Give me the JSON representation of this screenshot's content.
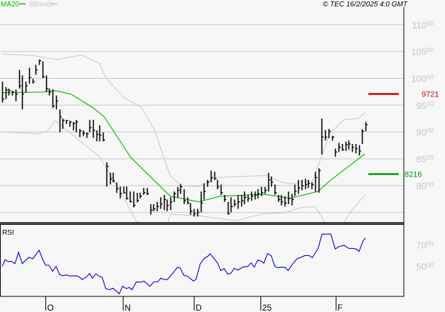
{
  "chart_data": {
    "type": "ohlc",
    "header": {
      "legend": [
        {
          "name": "MA20",
          "color": "#00c000"
        },
        {
          "name": "BBands",
          "color": "#c8c8c8"
        }
      ],
      "copyright": "© TEC 16/2/2025 4:0 GMT"
    },
    "price_axis": {
      "ylim": [
        7310,
        11460
      ],
      "gridlines": [
        11000,
        10500,
        10000,
        9500,
        9000,
        8500,
        8000,
        7500
      ],
      "labels": [
        {
          "main": "110",
          "sup": "00",
          "value": 11000
        },
        {
          "main": "105",
          "sup": "00",
          "value": 10500
        },
        {
          "main": "100",
          "sup": "00",
          "value": 10000
        },
        {
          "main": "95",
          "sup": "00",
          "value": 9500
        },
        {
          "main": "90",
          "sup": "00",
          "value": 9000
        },
        {
          "main": "85",
          "sup": "00",
          "value": 8500
        },
        {
          "main": "80",
          "sup": "00",
          "value": 8000
        }
      ]
    },
    "levels": [
      {
        "label": "9721",
        "value": 9721,
        "color": "#cc0000"
      },
      {
        "label": "8216",
        "value": 8216,
        "color": "#009900"
      }
    ],
    "x_ticks": [
      {
        "label": "O",
        "index": 12.9
      },
      {
        "label": "N",
        "index": 35.9
      },
      {
        "label": "D",
        "index": 57
      },
      {
        "label": "25",
        "index": 76.8
      },
      {
        "label": "F",
        "index": 99.2
      }
    ],
    "bars_hlc": [
      [
        9938,
        9550,
        9615
      ],
      [
        9835,
        9615,
        9783
      ],
      [
        9810,
        9680,
        9770
      ],
      [
        9770,
        9680,
        9744
      ],
      [
        9795,
        9575,
        9705
      ],
      [
        10158,
        9810,
        9860
      ],
      [
        10055,
        9420,
        9705
      ],
      [
        9938,
        9730,
        9860
      ],
      [
        10197,
        9900,
        10016
      ],
      [
        9990,
        9900,
        9938
      ],
      [
        10250,
        10068,
        10158
      ],
      [
        10350,
        10250,
        10327
      ],
      [
        10315,
        10003,
        10030
      ],
      [
        10055,
        9744,
        9810
      ],
      [
        9810,
        9680,
        9744
      ],
      [
        9795,
        9446,
        9485
      ],
      [
        9680,
        9420,
        9576
      ],
      [
        9420,
        8993,
        9278
      ],
      [
        9252,
        9057,
        9213
      ],
      [
        9226,
        9148,
        9213
      ],
      [
        9213,
        9096,
        9187
      ],
      [
        9187,
        9031,
        9160
      ],
      [
        9226,
        8993,
        9187
      ],
      [
        9057,
        8902,
        9018
      ],
      [
        9031,
        8928,
        8980
      ],
      [
        8993,
        8890,
        8967
      ],
      [
        9226,
        8993,
        9083
      ],
      [
        9226,
        8890,
        9031
      ],
      [
        9031,
        8825,
        8954
      ],
      [
        9122,
        8825,
        8940
      ],
      [
        8993,
        8825,
        8850
      ],
      [
        8436,
        7983,
        8358
      ],
      [
        8242,
        8022,
        8125
      ],
      [
        8242,
        8060,
        8086
      ],
      [
        8060,
        7866,
        7944
      ],
      [
        7983,
        7763,
        7853
      ],
      [
        7983,
        7853,
        7866
      ],
      [
        7983,
        7737,
        7763
      ],
      [
        7892,
        7686,
        7700
      ],
      [
        7892,
        7594,
        7633
      ],
      [
        7866,
        7686,
        7724
      ],
      [
        7870,
        7761,
        7805
      ],
      [
        7956,
        7826,
        7870
      ],
      [
        7956,
        7826,
        7848
      ],
      [
        7654,
        7459,
        7545
      ],
      [
        7654,
        7524,
        7567
      ],
      [
        7697,
        7524,
        7610
      ],
      [
        7783,
        7567,
        7654
      ],
      [
        7826,
        7545,
        7740
      ],
      [
        7740,
        7524,
        7632
      ],
      [
        7783,
        7545,
        7697
      ],
      [
        7891,
        7697,
        7848
      ],
      [
        7978,
        7783,
        7913
      ],
      [
        8030,
        7848,
        7978
      ],
      [
        7934,
        7654,
        7718
      ],
      [
        7783,
        7654,
        7675
      ],
      [
        7675,
        7459,
        7524
      ],
      [
        7567,
        7425,
        7480
      ],
      [
        7567,
        7425,
        7502
      ],
      [
        7891,
        7502,
        7675
      ],
      [
        8042,
        7740,
        7891
      ],
      [
        8107,
        7978,
        8064
      ],
      [
        8280,
        8064,
        8150
      ],
      [
        8258,
        8107,
        8129
      ],
      [
        8107,
        7934,
        7978
      ],
      [
        8021,
        7826,
        7870
      ],
      [
        7826,
        7697,
        7740
      ],
      [
        7697,
        7459,
        7480
      ],
      [
        7783,
        7502,
        7610
      ],
      [
        7740,
        7610,
        7654
      ],
      [
        7826,
        7567,
        7697
      ],
      [
        7826,
        7610,
        7718
      ],
      [
        7891,
        7654,
        7783
      ],
      [
        7826,
        7697,
        7761
      ],
      [
        7891,
        7718,
        7805
      ],
      [
        7891,
        7740,
        7826
      ],
      [
        7934,
        7761,
        7848
      ],
      [
        7978,
        7805,
        7870
      ],
      [
        7978,
        7848,
        7913
      ],
      [
        8237,
        7891,
        8107
      ],
      [
        8172,
        7978,
        8064
      ],
      [
        8021,
        7826,
        7870
      ],
      [
        7826,
        7697,
        7740
      ],
      [
        7826,
        7632,
        7697
      ],
      [
        7805,
        7610,
        7675
      ],
      [
        7891,
        7654,
        7761
      ],
      [
        7848,
        7632,
        7740
      ],
      [
        8021,
        7805,
        7891
      ],
      [
        8107,
        7848,
        7956
      ],
      [
        8107,
        7913,
        7999
      ],
      [
        8129,
        7934,
        8021
      ],
      [
        8107,
        7956,
        8042
      ],
      [
        8064,
        7934,
        8021
      ],
      [
        8258,
        7891,
        8150
      ],
      [
        8324,
        7870,
        8280
      ],
      [
        9252,
        8583,
        8906
      ],
      [
        9036,
        8842,
        8906
      ],
      [
        9057,
        8885,
        9014
      ],
      [
        8928,
        8842,
        8906
      ],
      [
        8690,
        8540,
        8626
      ],
      [
        8798,
        8626,
        8712
      ],
      [
        8777,
        8647,
        8669
      ],
      [
        8820,
        8647,
        8764
      ],
      [
        8842,
        8669,
        8777
      ],
      [
        8777,
        8626,
        8712
      ],
      [
        8777,
        8604,
        8690
      ],
      [
        8755,
        8561,
        8647
      ],
      [
        9049,
        8777,
        9014
      ],
      [
        9187,
        9014,
        9135
      ]
    ],
    "ma20": [
      [
        0,
        9731
      ],
      [
        12,
        9744
      ],
      [
        15.8,
        9770
      ],
      [
        20.5,
        9705
      ],
      [
        27.2,
        9446
      ],
      [
        30.4,
        9278
      ],
      [
        38.2,
        8527
      ],
      [
        50,
        7801
      ],
      [
        58.4,
        7698
      ],
      [
        64.8,
        7801
      ],
      [
        77.8,
        7840
      ],
      [
        85.4,
        7763
      ],
      [
        93.9,
        7892
      ],
      [
        97.3,
        8086
      ],
      [
        102.7,
        8345
      ],
      [
        107.8,
        8591
      ]
    ],
    "bband_upper": [
      [
        0,
        10456
      ],
      [
        9.9,
        10417
      ],
      [
        16.2,
        10350
      ],
      [
        23.6,
        10432
      ],
      [
        28.9,
        10285
      ],
      [
        31,
        9990
      ],
      [
        36.3,
        9640
      ],
      [
        41.6,
        9446
      ],
      [
        45.4,
        9018
      ],
      [
        50,
        8177
      ],
      [
        53.4,
        7996
      ],
      [
        58.4,
        7983
      ],
      [
        63.5,
        8151
      ],
      [
        73.6,
        8177
      ],
      [
        78.7,
        8190
      ],
      [
        82.1,
        8086
      ],
      [
        85.4,
        8034
      ],
      [
        92.2,
        8086
      ],
      [
        95.2,
        8579
      ],
      [
        97.3,
        8967
      ],
      [
        101.5,
        9226
      ],
      [
        105.7,
        9252
      ],
      [
        107.8,
        9355
      ]
    ],
    "bband_lower": [
      [
        0,
        9005
      ],
      [
        10.3,
        8967
      ],
      [
        13.3,
        9005
      ],
      [
        15.8,
        9213
      ],
      [
        20.5,
        8967
      ],
      [
        28.9,
        8540
      ],
      [
        34.8,
        7930
      ],
      [
        39.9,
        7335
      ],
      [
        44.7,
        7100
      ],
      [
        49.2,
        7300
      ],
      [
        50,
        7465
      ],
      [
        58.4,
        7440
      ],
      [
        69.4,
        7348
      ],
      [
        77.8,
        7478
      ],
      [
        83.8,
        7491
      ],
      [
        88.8,
        7594
      ],
      [
        93,
        7607
      ],
      [
        96,
        7310
      ],
      [
        98.5,
        7150
      ],
      [
        101.5,
        7300
      ],
      [
        104,
        7542
      ],
      [
        107.8,
        7827
      ]
    ],
    "rsi": {
      "title": "RSI",
      "ylim": [
        21.3,
        89.3
      ],
      "labels": [
        {
          "main": "70",
          "sup": "00",
          "value": 70
        },
        {
          "main": "50",
          "sup": "00",
          "value": 50
        }
      ],
      "points": [
        [
          0,
          49.8
        ],
        [
          0.9,
          56.2
        ],
        [
          1.9,
          54.2
        ],
        [
          2.7,
          54.7
        ],
        [
          3.8,
          52.4
        ],
        [
          4.9,
          63.1
        ],
        [
          6,
          52.4
        ],
        [
          7,
          55.8
        ],
        [
          8,
          58.4
        ],
        [
          9.1,
          56.9
        ],
        [
          11,
          65.1
        ],
        [
          12,
          56.9
        ],
        [
          12.9,
          50.9
        ],
        [
          13.9,
          50.9
        ],
        [
          15,
          45.1
        ],
        [
          16,
          49.8
        ],
        [
          17.1,
          42
        ],
        [
          18.1,
          40.9
        ],
        [
          19.2,
          41.8
        ],
        [
          20,
          40.7
        ],
        [
          22.2,
          40.9
        ],
        [
          23,
          39.6
        ],
        [
          23.8,
          37.3
        ],
        [
          25.1,
          39.8
        ],
        [
          26,
          43.1
        ],
        [
          26.8,
          38.7
        ],
        [
          27.9,
          42.7
        ],
        [
          28.9,
          40.2
        ],
        [
          29.7,
          39.6
        ],
        [
          30.8,
          28.7
        ],
        [
          31.9,
          27.6
        ],
        [
          32.9,
          29.1
        ],
        [
          34,
          26.2
        ],
        [
          34.8,
          23.8
        ],
        [
          35.8,
          30.9
        ],
        [
          36.9,
          28.7
        ],
        [
          37.8,
          29.8
        ],
        [
          38.6,
          27.6
        ],
        [
          39.9,
          35.1
        ],
        [
          41.1,
          34.7
        ],
        [
          42.2,
          35.8
        ],
        [
          43.9,
          30.9
        ],
        [
          45.1,
          35.1
        ],
        [
          46.2,
          35.1
        ],
        [
          47.2,
          38.7
        ],
        [
          48.1,
          37.3
        ],
        [
          49.1,
          37.3
        ],
        [
          50.4,
          42
        ],
        [
          52.1,
          48.9
        ],
        [
          52.9,
          48.4
        ],
        [
          54,
          41.3
        ],
        [
          55.1,
          40.4
        ],
        [
          55.9,
          38.4
        ],
        [
          56.8,
          36
        ],
        [
          57.6,
          37.3
        ],
        [
          58.9,
          52.4
        ],
        [
          60.1,
          57.6
        ],
        [
          61,
          59.1
        ],
        [
          61.8,
          61.6
        ],
        [
          62.7,
          58.4
        ],
        [
          64,
          53.1
        ],
        [
          65,
          45.8
        ],
        [
          66,
          47.6
        ],
        [
          67.1,
          42.4
        ],
        [
          68.1,
          43.6
        ],
        [
          69,
          48
        ],
        [
          70.1,
          46.2
        ],
        [
          71.5,
          49.1
        ],
        [
          73,
          49.8
        ],
        [
          74,
          53.1
        ],
        [
          74.9,
          49.1
        ],
        [
          76,
          55.8
        ],
        [
          77,
          54.7
        ],
        [
          77.8,
          52.9
        ],
        [
          78.9,
          62.2
        ],
        [
          80,
          59.8
        ],
        [
          81,
          50.2
        ],
        [
          81.9,
          48.4
        ],
        [
          82.9,
          49.1
        ],
        [
          84.2,
          48.7
        ],
        [
          85,
          45.8
        ],
        [
          86.3,
          52
        ],
        [
          87.6,
          56.9
        ],
        [
          88.8,
          58.4
        ],
        [
          90.1,
          60.2
        ],
        [
          91.3,
          60
        ],
        [
          92.2,
          58
        ],
        [
          93,
          62.4
        ],
        [
          93.9,
          66.9
        ],
        [
          95.1,
          80.4
        ],
        [
          97.7,
          80.4
        ],
        [
          99,
          66.4
        ],
        [
          100.2,
          68.7
        ],
        [
          101.7,
          69.8
        ],
        [
          103,
          66.9
        ],
        [
          104.2,
          66.9
        ],
        [
          105.3,
          66.2
        ],
        [
          106.1,
          64
        ],
        [
          107.2,
          73.6
        ],
        [
          108,
          76.9
        ]
      ]
    }
  }
}
